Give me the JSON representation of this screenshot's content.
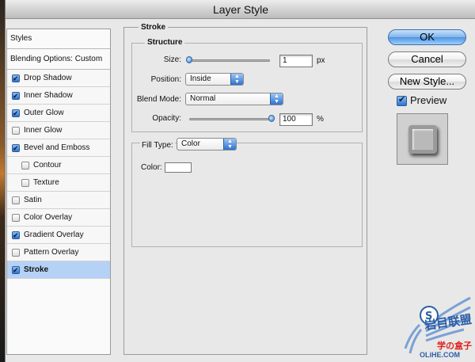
{
  "window": {
    "title": "Layer Style"
  },
  "styles_panel": {
    "header": "Styles",
    "blending_options": "Blending Options: Custom",
    "items": [
      {
        "label": "Drop Shadow",
        "checked": true,
        "indent": false,
        "selected": false
      },
      {
        "label": "Inner Shadow",
        "checked": true,
        "indent": false,
        "selected": false
      },
      {
        "label": "Outer Glow",
        "checked": true,
        "indent": false,
        "selected": false
      },
      {
        "label": "Inner Glow",
        "checked": false,
        "indent": false,
        "selected": false
      },
      {
        "label": "Bevel and Emboss",
        "checked": true,
        "indent": false,
        "selected": false
      },
      {
        "label": "Contour",
        "checked": false,
        "indent": true,
        "selected": false
      },
      {
        "label": "Texture",
        "checked": false,
        "indent": true,
        "selected": false
      },
      {
        "label": "Satin",
        "checked": false,
        "indent": false,
        "selected": false
      },
      {
        "label": "Color Overlay",
        "checked": false,
        "indent": false,
        "selected": false
      },
      {
        "label": "Gradient Overlay",
        "checked": true,
        "indent": false,
        "selected": false
      },
      {
        "label": "Pattern Overlay",
        "checked": false,
        "indent": false,
        "selected": false
      },
      {
        "label": "Stroke",
        "checked": true,
        "indent": false,
        "selected": true
      }
    ]
  },
  "stroke": {
    "section_title": "Stroke",
    "structure_title": "Structure",
    "size": {
      "label": "Size:",
      "value": "1",
      "unit": "px"
    },
    "position": {
      "label": "Position:",
      "value": "Inside"
    },
    "blend_mode": {
      "label": "Blend Mode:",
      "value": "Normal"
    },
    "opacity": {
      "label": "Opacity:",
      "value": "100",
      "unit": "%"
    },
    "fill_type": {
      "label": "Fill Type:",
      "value": "Color"
    },
    "color": {
      "label": "Color:",
      "swatch": "#ffffff"
    }
  },
  "buttons": {
    "ok": "OK",
    "cancel": "Cancel",
    "new_style": "New Style..."
  },
  "preview": {
    "label": "Preview",
    "checked": true
  },
  "watermark": {
    "brand": "岩目联盟",
    "red": "学の盒子",
    "url": "OLiHE.COM"
  },
  "colors": {
    "accent": "#2b74cf",
    "selected_row": "#b5d1f6"
  }
}
